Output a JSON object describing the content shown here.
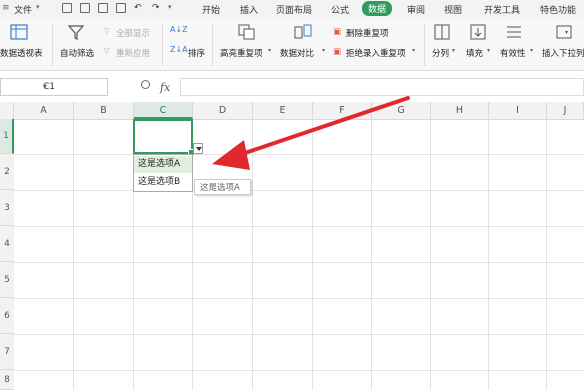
{
  "menubar": {
    "file_label": "文件",
    "tabs": [
      "开始",
      "插入",
      "页面布局",
      "公式",
      "数据",
      "审阅",
      "视图",
      "开发工具",
      "特色功能"
    ],
    "active_tab": "数据"
  },
  "ribbon": {
    "pivot_label": "数据透视表",
    "autofilter_label": "自动筛选",
    "show_all_label": "全部显示",
    "reapply_label": "重新应用",
    "sort_label": "排序",
    "highlight_dup_label": "高亮重复项",
    "compare_label": "数据对比",
    "delete_dup_label": "删除重复项",
    "reject_dup_label": "拒绝录入重复项",
    "split_label": "分列",
    "fill_label": "填充",
    "validity_label": "有效性",
    "insert_dropdown_label": "插入下拉列"
  },
  "formula_bar": {
    "cell_ref": "C1",
    "fx": "fx",
    "value": ""
  },
  "columns": [
    "A",
    "B",
    "C",
    "D",
    "E",
    "F",
    "G",
    "H",
    "I",
    "J"
  ],
  "selected_column": "C",
  "rows": [
    "1",
    "2",
    "3",
    "4",
    "5",
    "6",
    "7",
    "8"
  ],
  "selected_row": "1",
  "dropdown": {
    "options": [
      "这是选项A",
      "这是选项B"
    ],
    "highlighted": 0
  },
  "tooltip": "这是选项A",
  "colors": {
    "accent": "#2e9c5c",
    "arrow": "#e0282e"
  }
}
